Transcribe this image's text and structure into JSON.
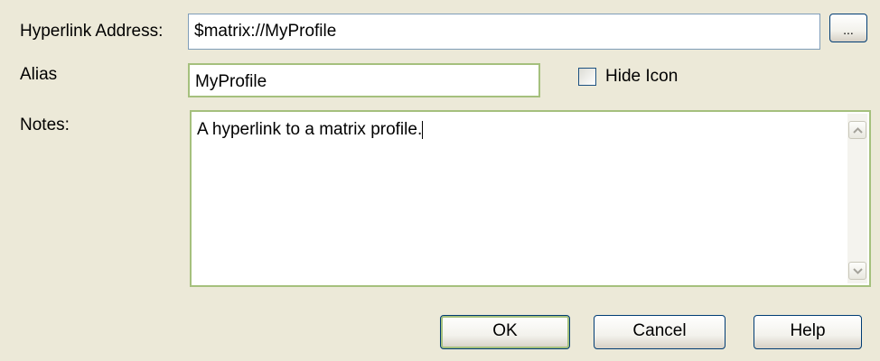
{
  "form": {
    "hyperlink_label": "Hyperlink Address:",
    "hyperlink_value": "$matrix://MyProfile",
    "browse_label": "...",
    "alias_label": "Alias",
    "alias_value": "MyProfile",
    "hide_icon_label": "Hide Icon",
    "hide_icon_checked": false,
    "notes_label": "Notes:",
    "notes_value": "A hyperlink to a matrix profile."
  },
  "buttons": {
    "ok_label": "OK",
    "cancel_label": "Cancel",
    "help_label": "Help"
  },
  "icons": {
    "scroll_up": "scroll-up-arrow-icon",
    "scroll_down": "scroll-down-arrow-icon"
  },
  "colors": {
    "dialog_bg": "#ece9d8",
    "field_border": "#7f9db9",
    "focus_border": "#a5c07d",
    "button_border": "#003c74"
  }
}
